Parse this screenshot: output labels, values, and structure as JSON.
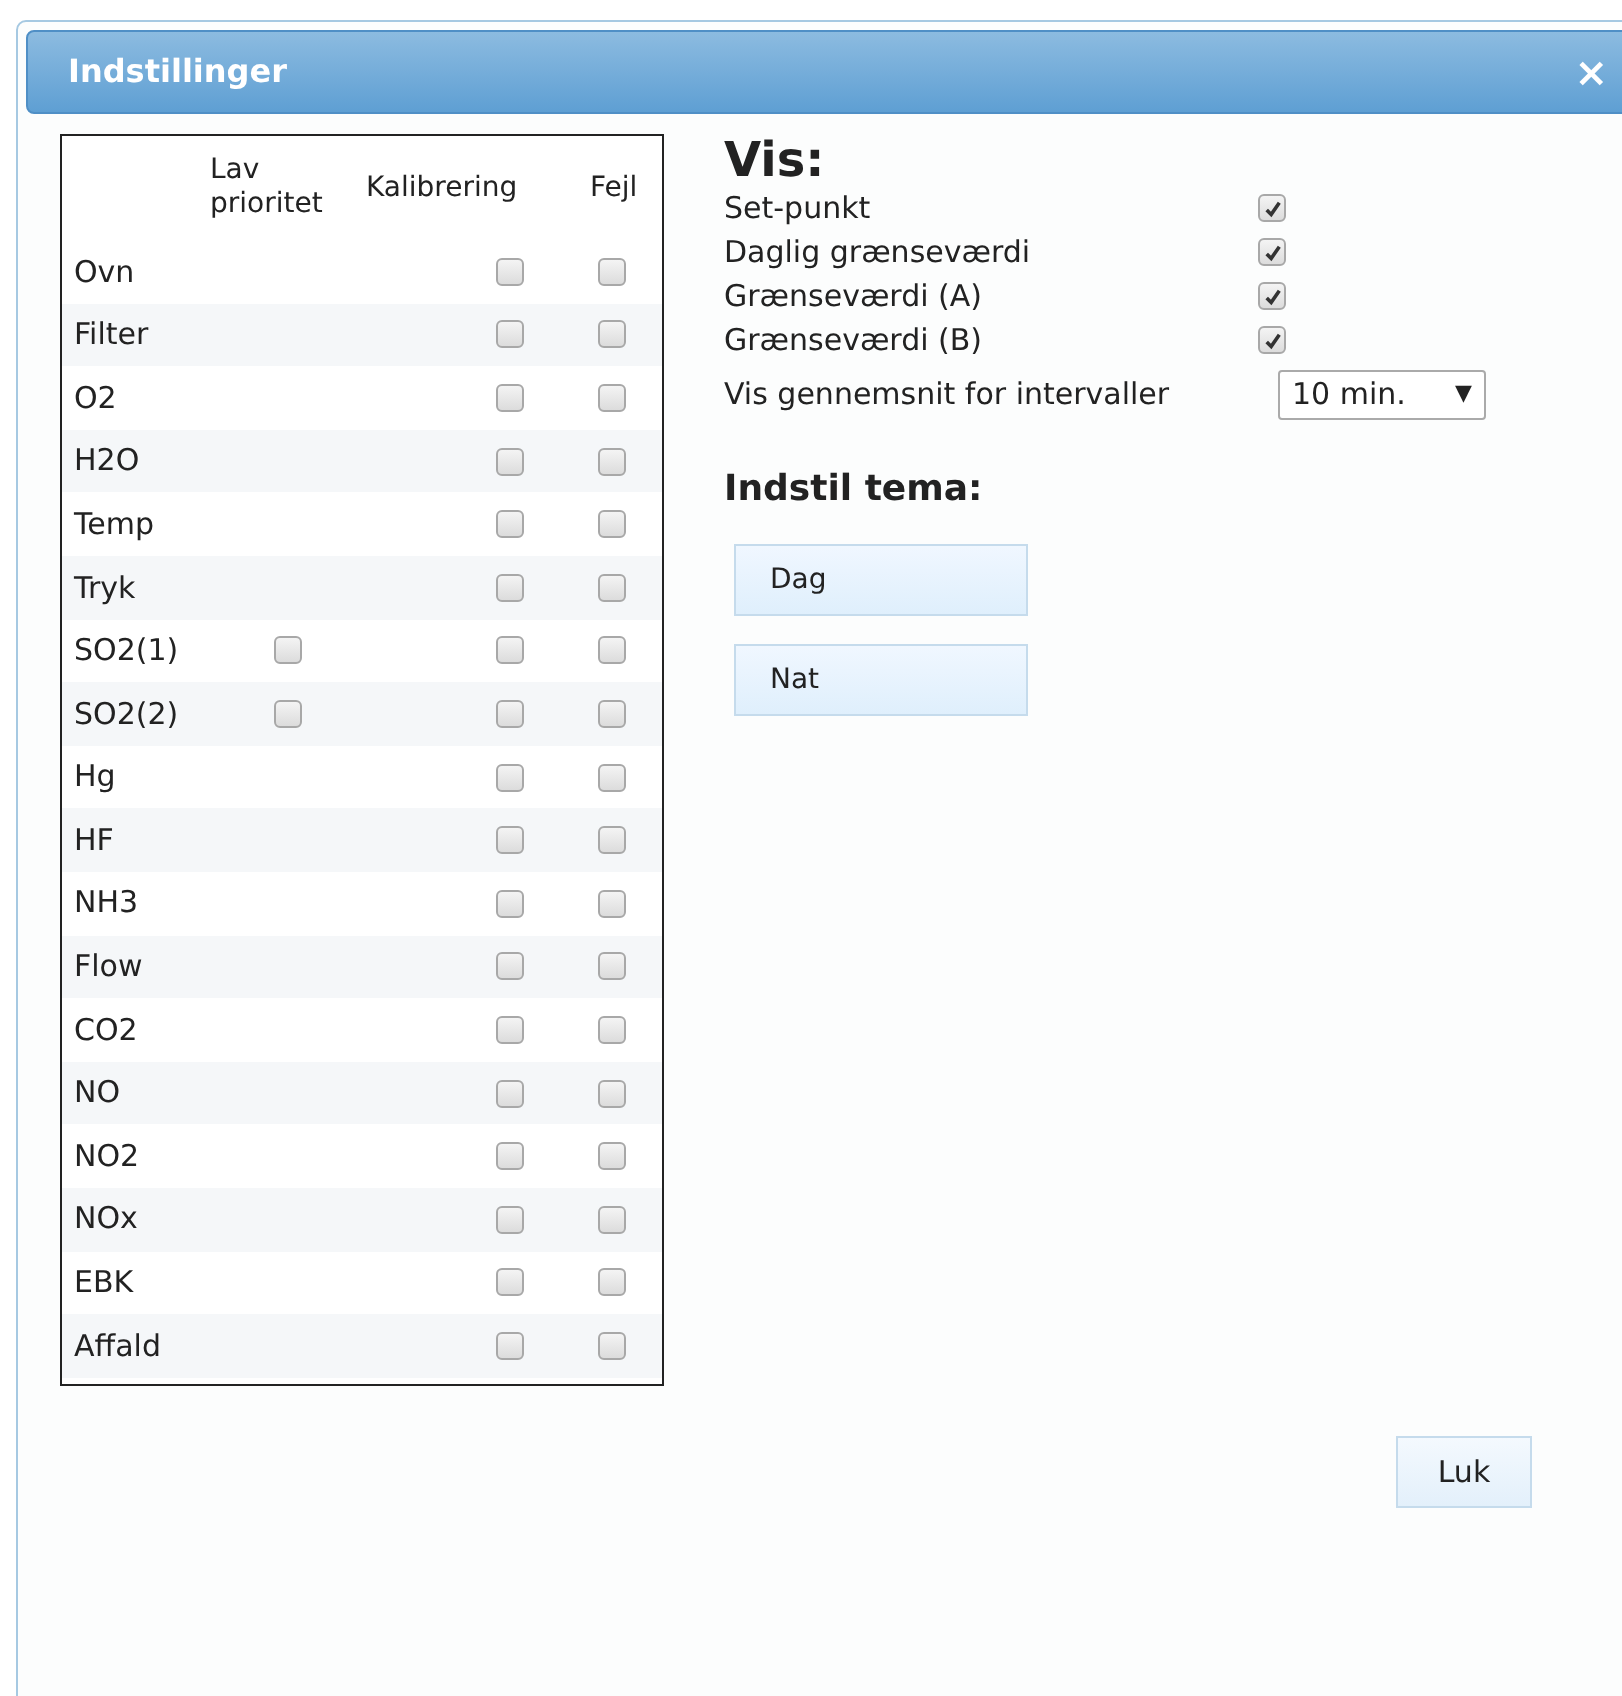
{
  "window": {
    "title": "Indstillinger",
    "close": "×"
  },
  "table": {
    "columns": [
      "Lav prioritet",
      "Kalibrering",
      "Fejl"
    ],
    "rows": [
      {
        "name": "Ovn",
        "calibration": false,
        "error": false
      },
      {
        "name": "Filter",
        "calibration": false,
        "error": false
      },
      {
        "name": "O2",
        "calibration": false,
        "error": false
      },
      {
        "name": "H2O",
        "calibration": false,
        "error": false
      },
      {
        "name": "Temp",
        "calibration": false,
        "error": false
      },
      {
        "name": "Tryk",
        "calibration": false,
        "error": false
      },
      {
        "name": "SO2(1)",
        "low_priority": false,
        "calibration": false,
        "error": false
      },
      {
        "name": "SO2(2)",
        "low_priority": false,
        "calibration": false,
        "error": false
      },
      {
        "name": "Hg",
        "calibration": false,
        "error": false
      },
      {
        "name": "HF",
        "calibration": false,
        "error": false
      },
      {
        "name": "NH3",
        "calibration": false,
        "error": false
      },
      {
        "name": "Flow",
        "calibration": false,
        "error": false
      },
      {
        "name": "CO2",
        "calibration": false,
        "error": false
      },
      {
        "name": "NO",
        "calibration": false,
        "error": false
      },
      {
        "name": "NO2",
        "calibration": false,
        "error": false
      },
      {
        "name": "NOx",
        "calibration": false,
        "error": false
      },
      {
        "name": "EBK",
        "calibration": false,
        "error": false
      },
      {
        "name": "Affald",
        "calibration": false,
        "error": false
      }
    ]
  },
  "show": {
    "heading": "Vis:",
    "options": [
      {
        "label": "Set-punkt",
        "checked": true
      },
      {
        "label": "Daglig grænseværdi",
        "checked": true
      },
      {
        "label": "Grænseværdi (A)",
        "checked": true
      },
      {
        "label": "Grænseværdi (B)",
        "checked": true
      }
    ],
    "interval": {
      "label": "Vis gennemsnit for intervaller",
      "value": "10 min.",
      "arrow": "▼"
    }
  },
  "theme": {
    "heading": "Indstil tema:",
    "buttons": [
      "Dag",
      "Nat"
    ]
  },
  "close_button": "Luk"
}
